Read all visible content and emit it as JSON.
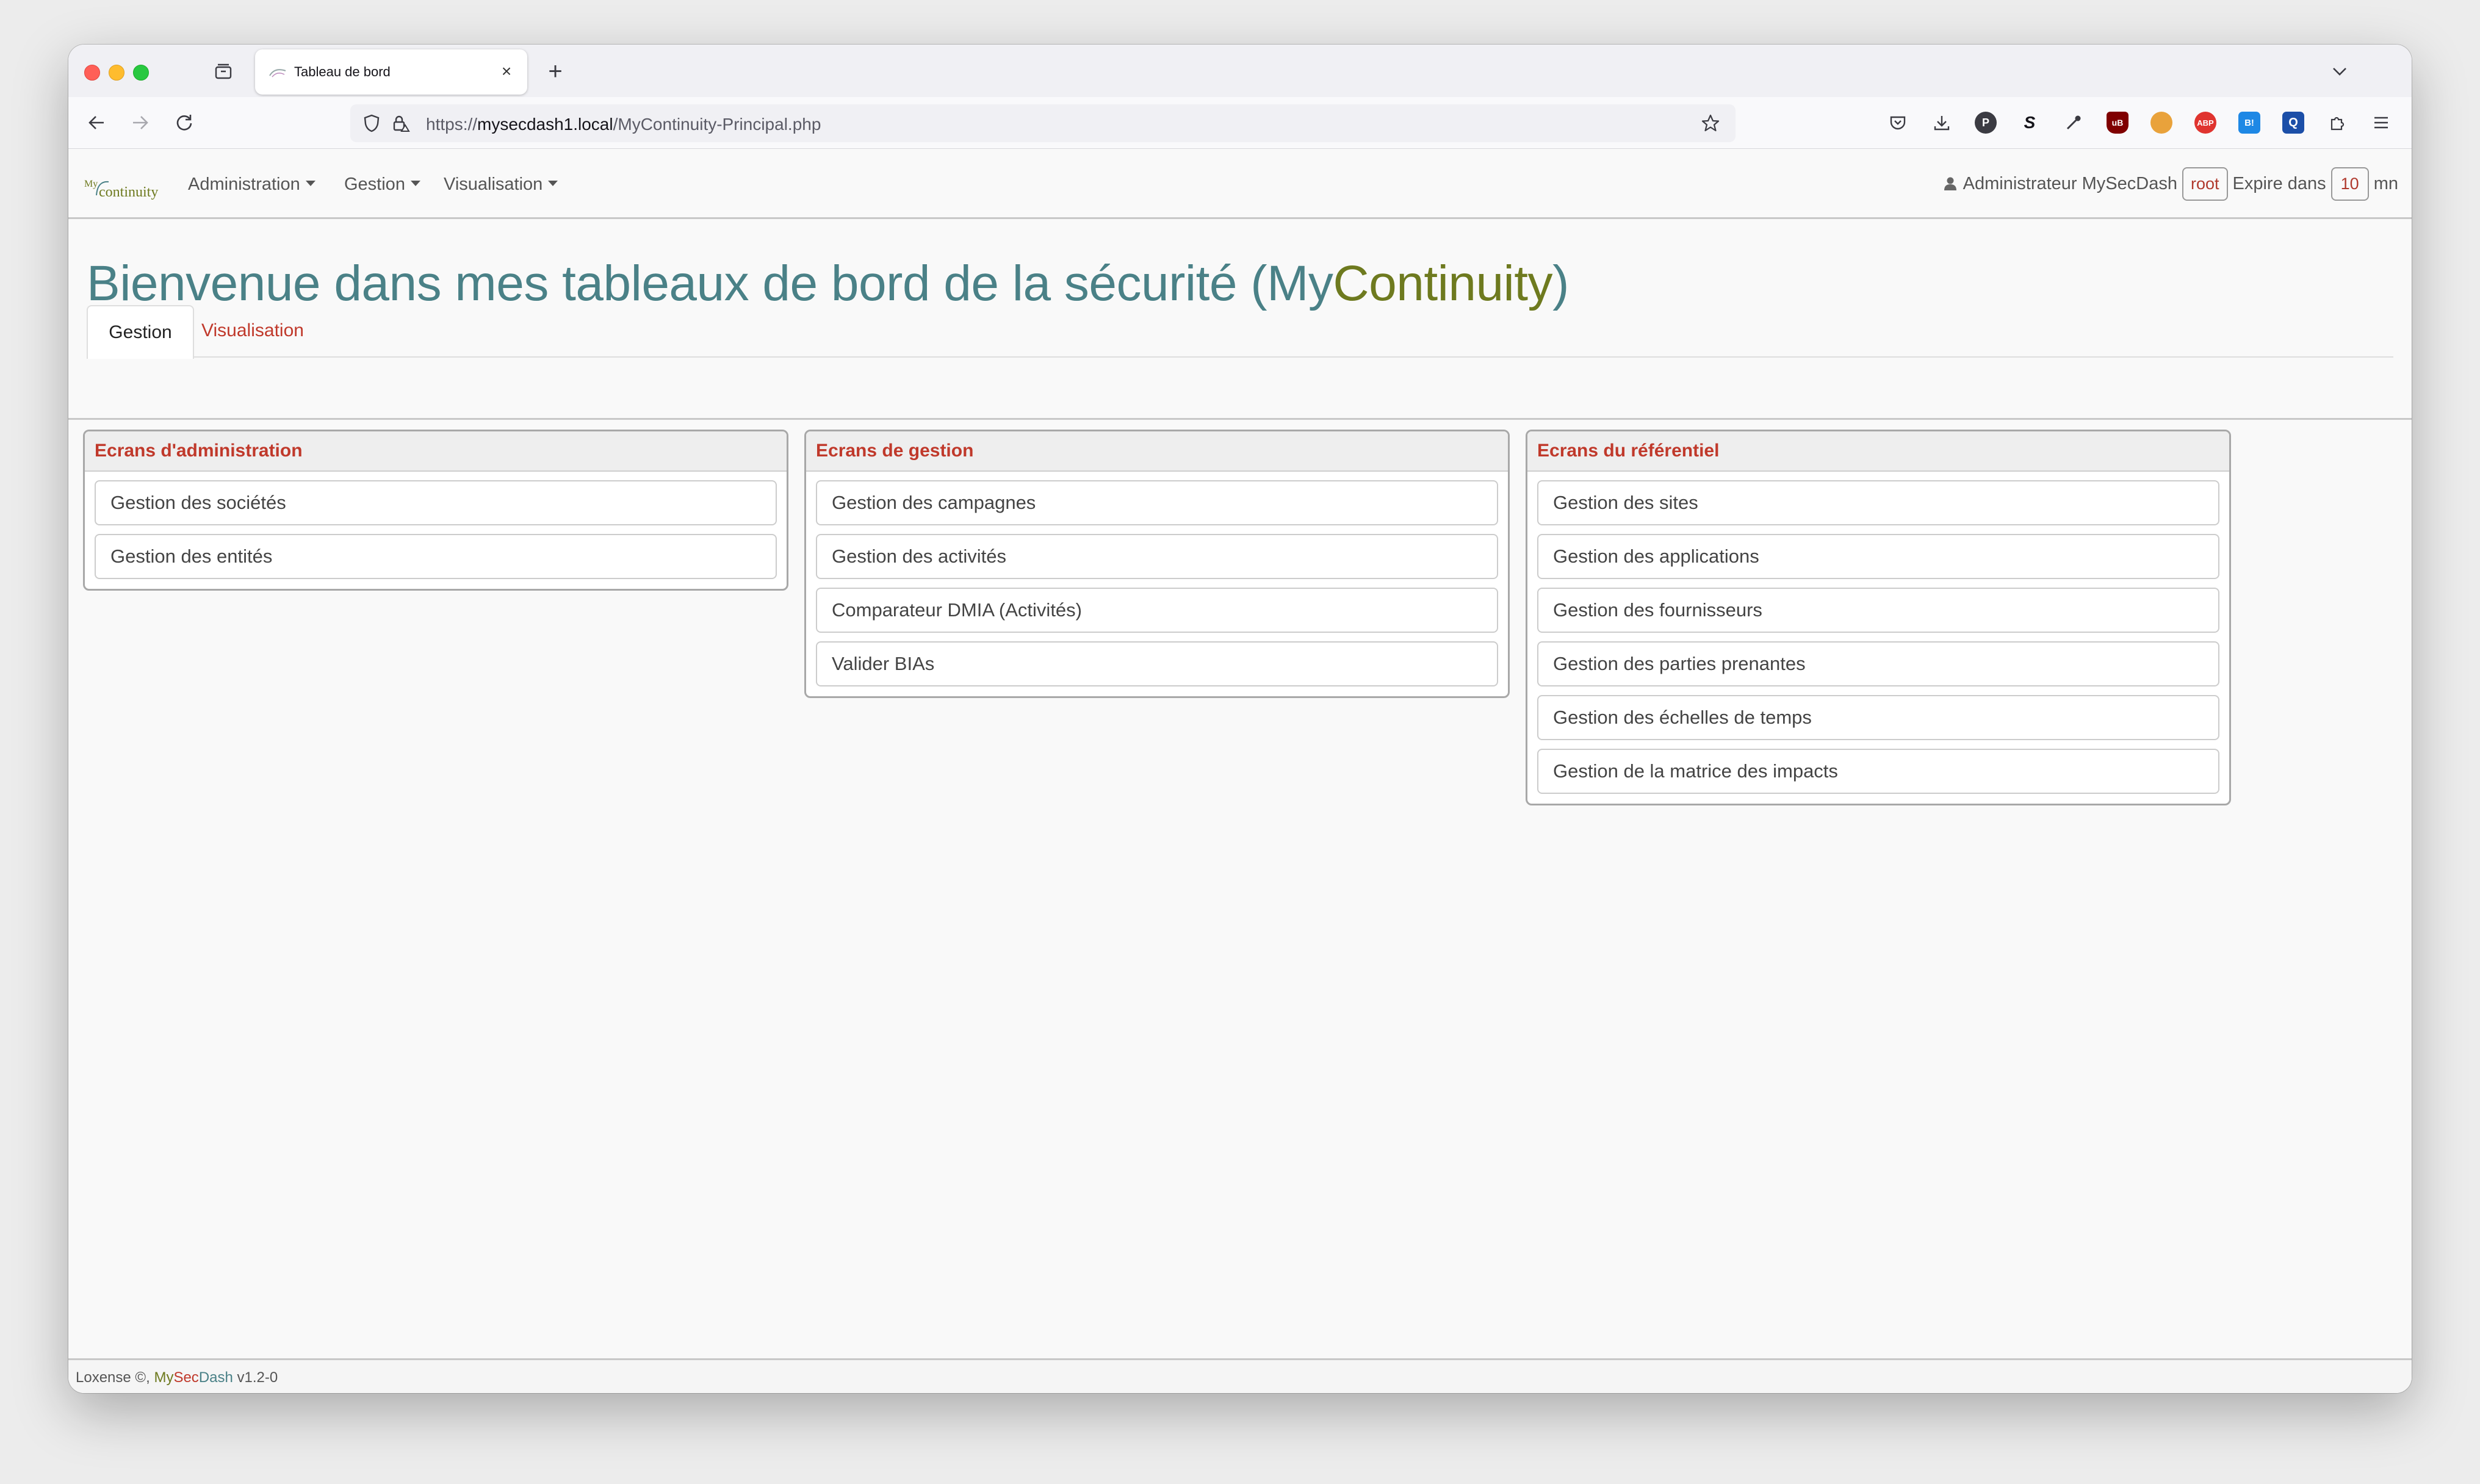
{
  "browser": {
    "tab_title": "Tableau de bord",
    "url_scheme": "https://",
    "url_host": "mysecdash1.local",
    "url_path": "/MyContinuity-Principal.php"
  },
  "app": {
    "logo_text_my": "My",
    "logo_text_continuity": "continuity",
    "menus": [
      "Administration",
      "Gestion",
      "Visualisation"
    ],
    "user": {
      "name": "Administrateur MySecDash",
      "login": "root",
      "expire_label": "Expire dans",
      "expire_value": "10",
      "expire_unit": "mn"
    }
  },
  "page": {
    "title_main": "Bienvenue dans mes tableaux de bord de la sécurité (My",
    "title_accent": "Continuity",
    "title_end": ")",
    "tabs": [
      {
        "label": "Gestion",
        "active": true
      },
      {
        "label": "Visualisation",
        "active": false
      }
    ]
  },
  "panels": [
    {
      "title": "Ecrans d'administration",
      "items": [
        "Gestion des sociétés",
        "Gestion des entités"
      ]
    },
    {
      "title": "Ecrans de gestion",
      "items": [
        "Gestion des campagnes",
        "Gestion des activités",
        "Comparateur DMIA (Activités)",
        "Valider BIAs"
      ]
    },
    {
      "title": "Ecrans du référentiel",
      "items": [
        "Gestion des sites",
        "Gestion des applications",
        "Gestion des fournisseurs",
        "Gestion des parties prenantes",
        "Gestion des échelles de temps",
        "Gestion de la matrice des impacts"
      ]
    }
  ],
  "footer": {
    "company": "Loxense",
    "copyright": "©",
    "brand_my": "My",
    "brand_sec": "Sec",
    "brand_dash": "Dash",
    "version": "v1.2-0"
  },
  "colors": {
    "accent_teal": "#4a8187",
    "accent_olive": "#6e7a1f",
    "accent_red": "#c0392b"
  }
}
